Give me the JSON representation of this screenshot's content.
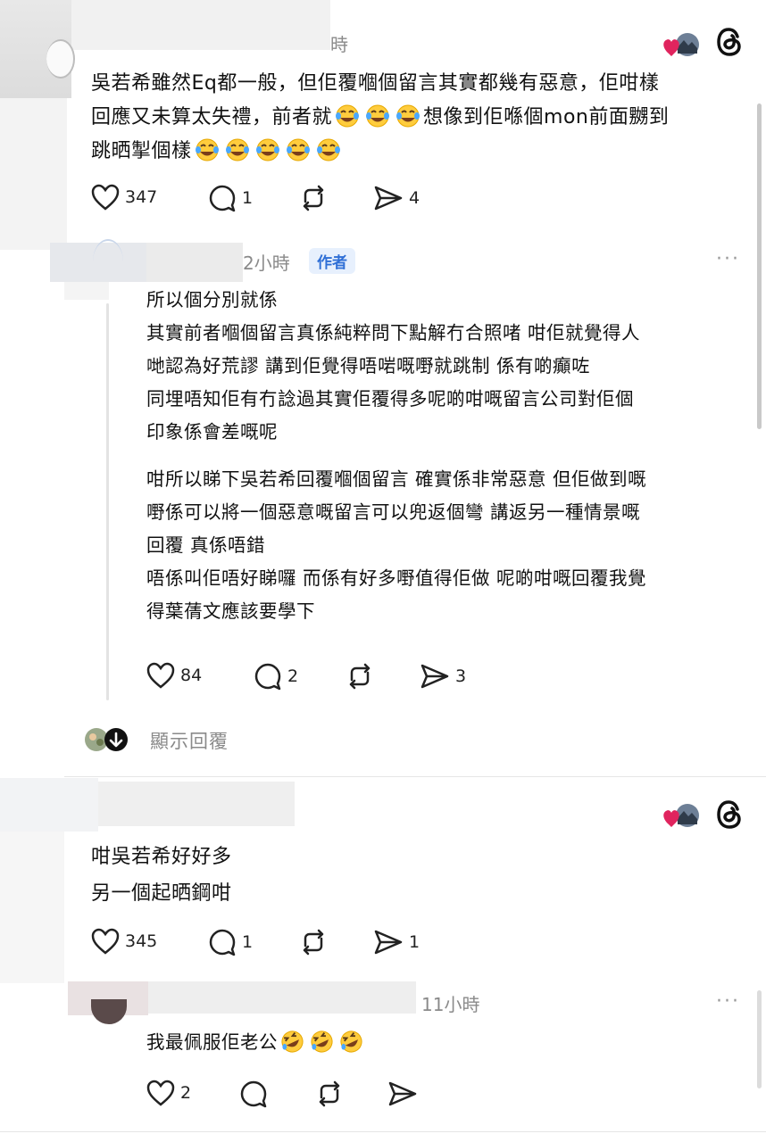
{
  "comment1": {
    "time_fragment": "時",
    "lines": [
      "吳若希雖然Eq都一般，但佢覆嗰個留言其實都幾有惡意，佢咁樣",
      "回應又未算太失禮，前者就",
      "想像到佢喺個mon前面嬲到",
      "跳晒掣個樣"
    ],
    "actions": {
      "likes": "347",
      "comments": "1",
      "shares": "4"
    }
  },
  "reply1": {
    "time": "2小時",
    "author_badge": "作者",
    "more": "···",
    "lines": [
      "所以個分別就係",
      "其實前者嗰個留言真係純粹問下點解冇合照啫 咁佢就覺得人",
      "哋認為好荒謬 講到佢覺得唔啱嘅嘢就跳制 係有啲癲咗",
      "同埋唔知佢有冇諗過其實佢覆得多呢啲咁嘅留言公司對佢個",
      "印象係會差嘅呢",
      "咁所以睇下吳若希回覆嗰個留言 確實係非常惡意 但佢做到嘅",
      "嘢係可以將一個惡意嘅留言可以兜返個彎 講返另一種情景嘅",
      "回覆 真係唔錯",
      "唔係叫佢唔好睇囉 而係有好多嘢值得佢做 呢啲咁嘅回覆我覺",
      "得葉蒨文應該要學下"
    ],
    "actions": {
      "likes": "84",
      "comments": "2",
      "shares": "3"
    }
  },
  "show_replies": "顯示回覆",
  "comment2": {
    "lines": [
      "咁吳若希好好多",
      "另一個起晒鋼咁"
    ],
    "actions": {
      "likes": "345",
      "comments": "1",
      "shares": "1"
    }
  },
  "reply2": {
    "time": "11小時",
    "more": "···",
    "text": "我最佩服佢老公",
    "actions": {
      "likes": "2"
    }
  },
  "icons": {
    "heart": "heart-icon",
    "comment": "comment-icon",
    "repost": "repost-icon",
    "share": "share-icon",
    "threads": "threads-logo-icon",
    "laugh": "tears-of-joy-emoji",
    "rofl": "rolling-laughing-emoji",
    "arrow": "arrow-down-icon"
  },
  "colors": {
    "accent": "#2f6fd6",
    "muted": "#8a8a8a",
    "heart_red": "#e0245e"
  }
}
